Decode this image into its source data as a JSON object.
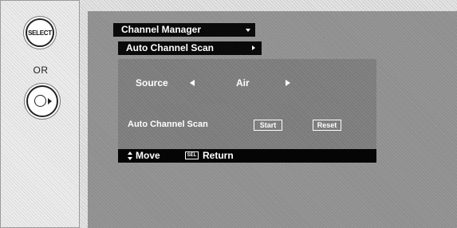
{
  "remote": {
    "select_label": "SELECT",
    "or_label": "OR"
  },
  "menu": {
    "title": "Channel Manager",
    "submenu": "Auto Channel Scan"
  },
  "source": {
    "label": "Source",
    "value": "Air"
  },
  "scan": {
    "label": "Auto Channel Scan",
    "start_label": "Start",
    "reset_label": "Reset"
  },
  "footer": {
    "move_label": "Move",
    "sel_icon_text": "SEL",
    "return_label": "Return"
  }
}
